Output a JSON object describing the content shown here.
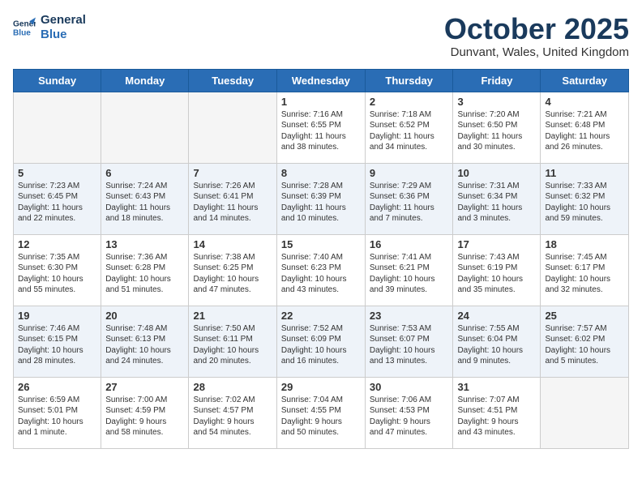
{
  "header": {
    "logo_line1": "General",
    "logo_line2": "Blue",
    "month": "October 2025",
    "location": "Dunvant, Wales, United Kingdom"
  },
  "weekdays": [
    "Sunday",
    "Monday",
    "Tuesday",
    "Wednesday",
    "Thursday",
    "Friday",
    "Saturday"
  ],
  "weeks": [
    [
      {
        "day": "",
        "info": ""
      },
      {
        "day": "",
        "info": ""
      },
      {
        "day": "",
        "info": ""
      },
      {
        "day": "1",
        "info": "Sunrise: 7:16 AM\nSunset: 6:55 PM\nDaylight: 11 hours\nand 38 minutes."
      },
      {
        "day": "2",
        "info": "Sunrise: 7:18 AM\nSunset: 6:52 PM\nDaylight: 11 hours\nand 34 minutes."
      },
      {
        "day": "3",
        "info": "Sunrise: 7:20 AM\nSunset: 6:50 PM\nDaylight: 11 hours\nand 30 minutes."
      },
      {
        "day": "4",
        "info": "Sunrise: 7:21 AM\nSunset: 6:48 PM\nDaylight: 11 hours\nand 26 minutes."
      }
    ],
    [
      {
        "day": "5",
        "info": "Sunrise: 7:23 AM\nSunset: 6:45 PM\nDaylight: 11 hours\nand 22 minutes."
      },
      {
        "day": "6",
        "info": "Sunrise: 7:24 AM\nSunset: 6:43 PM\nDaylight: 11 hours\nand 18 minutes."
      },
      {
        "day": "7",
        "info": "Sunrise: 7:26 AM\nSunset: 6:41 PM\nDaylight: 11 hours\nand 14 minutes."
      },
      {
        "day": "8",
        "info": "Sunrise: 7:28 AM\nSunset: 6:39 PM\nDaylight: 11 hours\nand 10 minutes."
      },
      {
        "day": "9",
        "info": "Sunrise: 7:29 AM\nSunset: 6:36 PM\nDaylight: 11 hours\nand 7 minutes."
      },
      {
        "day": "10",
        "info": "Sunrise: 7:31 AM\nSunset: 6:34 PM\nDaylight: 11 hours\nand 3 minutes."
      },
      {
        "day": "11",
        "info": "Sunrise: 7:33 AM\nSunset: 6:32 PM\nDaylight: 10 hours\nand 59 minutes."
      }
    ],
    [
      {
        "day": "12",
        "info": "Sunrise: 7:35 AM\nSunset: 6:30 PM\nDaylight: 10 hours\nand 55 minutes."
      },
      {
        "day": "13",
        "info": "Sunrise: 7:36 AM\nSunset: 6:28 PM\nDaylight: 10 hours\nand 51 minutes."
      },
      {
        "day": "14",
        "info": "Sunrise: 7:38 AM\nSunset: 6:25 PM\nDaylight: 10 hours\nand 47 minutes."
      },
      {
        "day": "15",
        "info": "Sunrise: 7:40 AM\nSunset: 6:23 PM\nDaylight: 10 hours\nand 43 minutes."
      },
      {
        "day": "16",
        "info": "Sunrise: 7:41 AM\nSunset: 6:21 PM\nDaylight: 10 hours\nand 39 minutes."
      },
      {
        "day": "17",
        "info": "Sunrise: 7:43 AM\nSunset: 6:19 PM\nDaylight: 10 hours\nand 35 minutes."
      },
      {
        "day": "18",
        "info": "Sunrise: 7:45 AM\nSunset: 6:17 PM\nDaylight: 10 hours\nand 32 minutes."
      }
    ],
    [
      {
        "day": "19",
        "info": "Sunrise: 7:46 AM\nSunset: 6:15 PM\nDaylight: 10 hours\nand 28 minutes."
      },
      {
        "day": "20",
        "info": "Sunrise: 7:48 AM\nSunset: 6:13 PM\nDaylight: 10 hours\nand 24 minutes."
      },
      {
        "day": "21",
        "info": "Sunrise: 7:50 AM\nSunset: 6:11 PM\nDaylight: 10 hours\nand 20 minutes."
      },
      {
        "day": "22",
        "info": "Sunrise: 7:52 AM\nSunset: 6:09 PM\nDaylight: 10 hours\nand 16 minutes."
      },
      {
        "day": "23",
        "info": "Sunrise: 7:53 AM\nSunset: 6:07 PM\nDaylight: 10 hours\nand 13 minutes."
      },
      {
        "day": "24",
        "info": "Sunrise: 7:55 AM\nSunset: 6:04 PM\nDaylight: 10 hours\nand 9 minutes."
      },
      {
        "day": "25",
        "info": "Sunrise: 7:57 AM\nSunset: 6:02 PM\nDaylight: 10 hours\nand 5 minutes."
      }
    ],
    [
      {
        "day": "26",
        "info": "Sunrise: 6:59 AM\nSunset: 5:01 PM\nDaylight: 10 hours\nand 1 minute."
      },
      {
        "day": "27",
        "info": "Sunrise: 7:00 AM\nSunset: 4:59 PM\nDaylight: 9 hours\nand 58 minutes."
      },
      {
        "day": "28",
        "info": "Sunrise: 7:02 AM\nSunset: 4:57 PM\nDaylight: 9 hours\nand 54 minutes."
      },
      {
        "day": "29",
        "info": "Sunrise: 7:04 AM\nSunset: 4:55 PM\nDaylight: 9 hours\nand 50 minutes."
      },
      {
        "day": "30",
        "info": "Sunrise: 7:06 AM\nSunset: 4:53 PM\nDaylight: 9 hours\nand 47 minutes."
      },
      {
        "day": "31",
        "info": "Sunrise: 7:07 AM\nSunset: 4:51 PM\nDaylight: 9 hours\nand 43 minutes."
      },
      {
        "day": "",
        "info": ""
      }
    ]
  ]
}
